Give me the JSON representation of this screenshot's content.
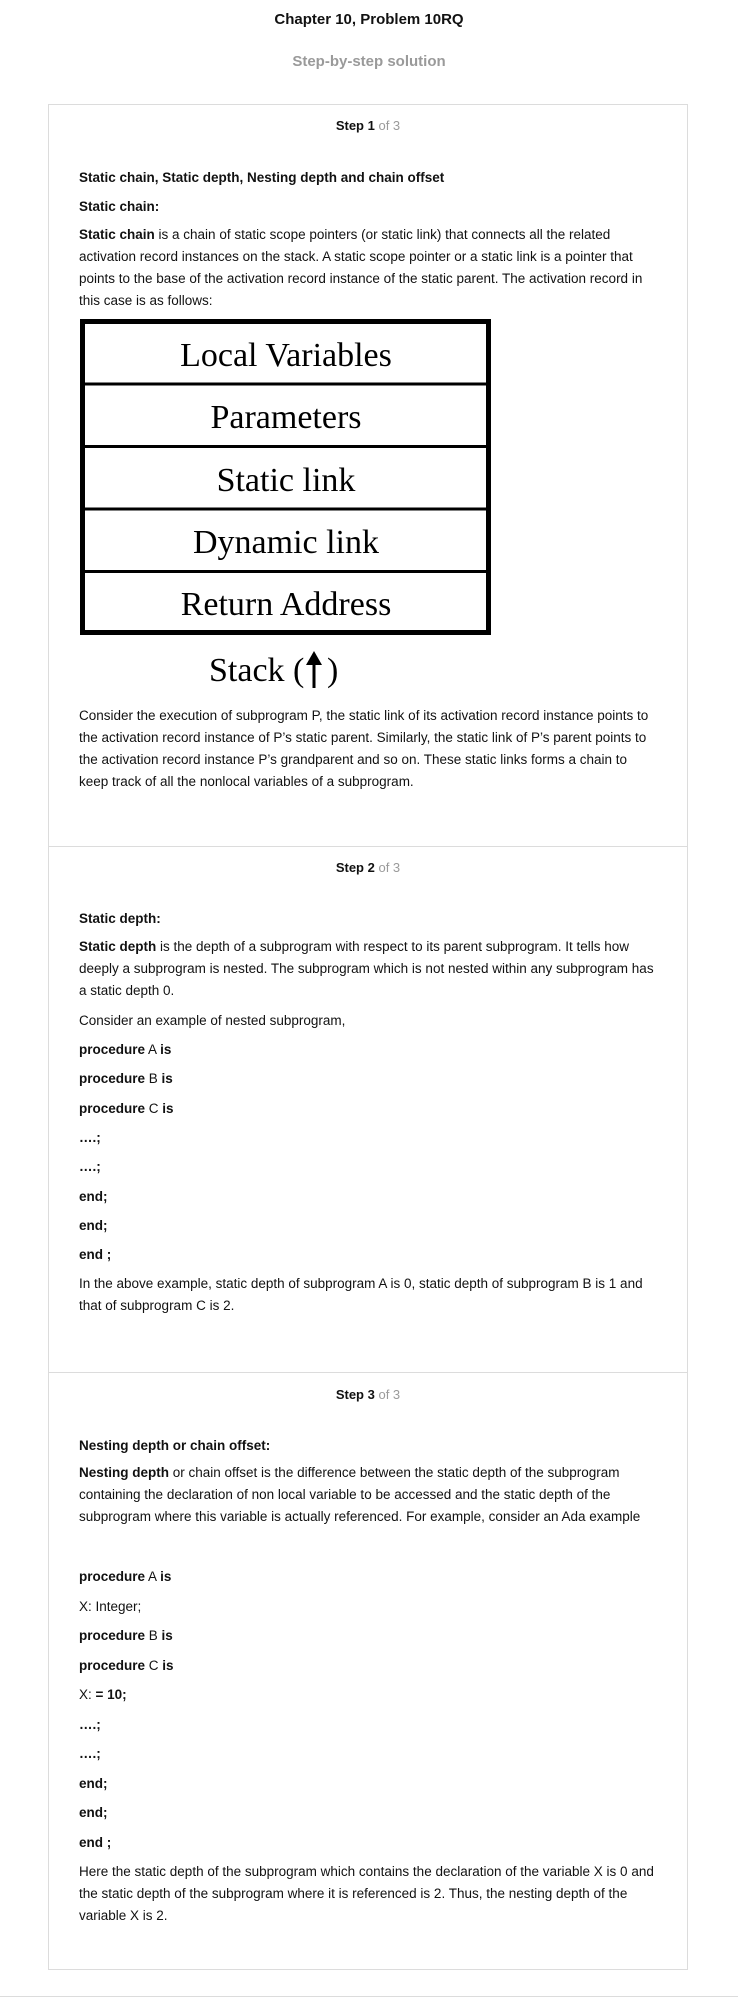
{
  "header": {
    "title": "Chapter 10, Problem 10RQ",
    "subtitle": "Step-by-step solution"
  },
  "steps": [
    {
      "label": "Step 1",
      "of": "of 3",
      "heading": "Static chain, Static depth, Nesting depth and chain offset",
      "subheading": "Static chain:",
      "term": "Static chain",
      "definition": " is a chain of static scope pointers (or static link) that connects all the related activation record instances on the stack. A static scope pointer or a static link is a pointer that points to the base of the activation record instance of the static parent. The activation record in this case is as follows:",
      "diagram": {
        "rows": [
          "Local Variables",
          "Parameters",
          "Static link",
          "Dynamic link",
          "Return Address"
        ],
        "caption": "Stack (",
        "caption_end": ")"
      },
      "conclusion": "Consider the execution of subprogram P, the static link of its activation record instance points to the activation record instance of P’s static parent. Similarly, the static link of P’s parent points to the activation record instance P’s grandparent and so on. These static links forms a chain to keep track of all the nonlocal variables of a subprogram."
    },
    {
      "label": "Step 2",
      "of": "of 3",
      "subheading": "Static depth:",
      "term": "Static depth",
      "definition": " is the depth of a subprogram with respect to its parent subprogram. It tells how deeply a subprogram is nested. The subprogram which is not nested within any subprogram has a static depth 0.",
      "intro": "Consider an example of nested subprogram,",
      "code": [
        {
          "kw1": "procedure",
          "name": " A ",
          "kw2": "is"
        },
        {
          "kw1": "procedure",
          "name": " B ",
          "kw2": "is"
        },
        {
          "kw1": "procedure",
          "name": " C ",
          "kw2": "is"
        },
        {
          "kw1": "….;",
          "name": "",
          "kw2": ""
        },
        {
          "kw1": "….;",
          "name": "",
          "kw2": ""
        },
        {
          "kw1": "end;",
          "name": "",
          "kw2": ""
        },
        {
          "kw1": "end;",
          "name": "",
          "kw2": ""
        },
        {
          "kw1": "end ;",
          "name": "",
          "kw2": ""
        }
      ],
      "conclusion": "In the above example, static depth of subprogram A is 0, static depth of subprogram B is 1 and that of subprogram C is 2."
    },
    {
      "label": "Step 3",
      "of": "of 3",
      "subheading": "Nesting depth or chain offset:",
      "term": "Nesting depth",
      "definition": " or chain offset is the difference between the static depth of the subprogram containing the declaration of non local variable to be accessed and the static depth of the subprogram where this variable is actually referenced. For example, consider an Ada example",
      "code": [
        {
          "kw1": "procedure",
          "name": " A ",
          "kw2": "is"
        },
        {
          "kw1": "",
          "name": "X: Integer;",
          "kw2": ""
        },
        {
          "kw1": "procedure",
          "name": " B ",
          "kw2": "is"
        },
        {
          "kw1": "procedure",
          "name": " C ",
          "kw2": "is"
        },
        {
          "kw1": "",
          "name": "X: ",
          "kw2": "= 10;"
        },
        {
          "kw1": "….;",
          "name": "",
          "kw2": ""
        },
        {
          "kw1": "….;",
          "name": "",
          "kw2": ""
        },
        {
          "kw1": "end;",
          "name": "",
          "kw2": ""
        },
        {
          "kw1": "end;",
          "name": "",
          "kw2": ""
        },
        {
          "kw1": "end ;",
          "name": "",
          "kw2": ""
        }
      ],
      "conclusion": "Here the static depth of the subprogram which contains the declaration of the variable X is 0 and the static depth of the subprogram where it is referenced is 2. Thus, the nesting depth of the variable X is 2."
    }
  ]
}
